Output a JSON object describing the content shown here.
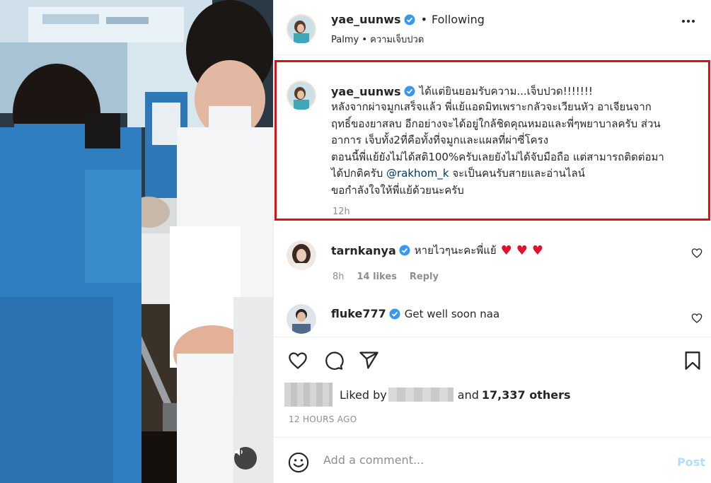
{
  "post": {
    "username": "yae_uunws",
    "follow_dot": "•",
    "follow_label": "Following",
    "subtitle": "Palmy • ความเจ็บปวด",
    "icons": {
      "more": "more-options-icon",
      "verified": "verified-badge-icon",
      "audio": "speaker-icon"
    }
  },
  "caption": {
    "username": "yae_uunws",
    "first_line": "ได้แต่ยินยอมรับความ...เจ็บปวด!!!!!!!",
    "lines": [
      "หลังจากผ่าจมูกเสร็จแล้ว พี่แย้แอดมิทเพราะกลัวจะเวียนหัว อาเจียนจาก",
      "ฤทธิ์ของยาสลบ อีกอย่างจะได้อยู่ใกล้ชิดคุณหมอและพี่ๆพยาบาลครับ ส่วน",
      "อาการ เจ็บทั้ง2ที่คือทั้งที่จมูกและแผลที่ผ่าซี่โครง",
      "ตอนนี้พี่แย้ยังไม่ได้สติ100%ครับเลยยังไม่ได้จับมือถือ แต่สามารถติดต่อมา"
    ],
    "line5_pre": "ได้ปกติครับ ",
    "mention": "@rakhom_k",
    "line5_post": " จะเป็นคนรับสายและอ่านไลน์",
    "last_line": "ขอกำลังใจให้พี่แย้ด้วยนะครับ",
    "time": "12h"
  },
  "comments": [
    {
      "username": "tarnkanya",
      "text": "หายไวๆนะคะพี่แย้",
      "hearts": "♥♥♥",
      "time": "8h",
      "likes": "14 likes",
      "reply": "Reply"
    },
    {
      "username": "fluke777",
      "text": "Get well soon naa"
    }
  ],
  "likes": {
    "liked_by": "Liked by",
    "and_text": "and",
    "count": "17,337 others"
  },
  "post_time": "12 HOURS AGO",
  "comment_bar": {
    "placeholder": "Add a comment...",
    "post_label": "Post"
  },
  "colors": {
    "accent_red_box": "#e01010",
    "link": "#00376b",
    "post_disabled": "#b2dffc",
    "heart": "#e0102f"
  }
}
